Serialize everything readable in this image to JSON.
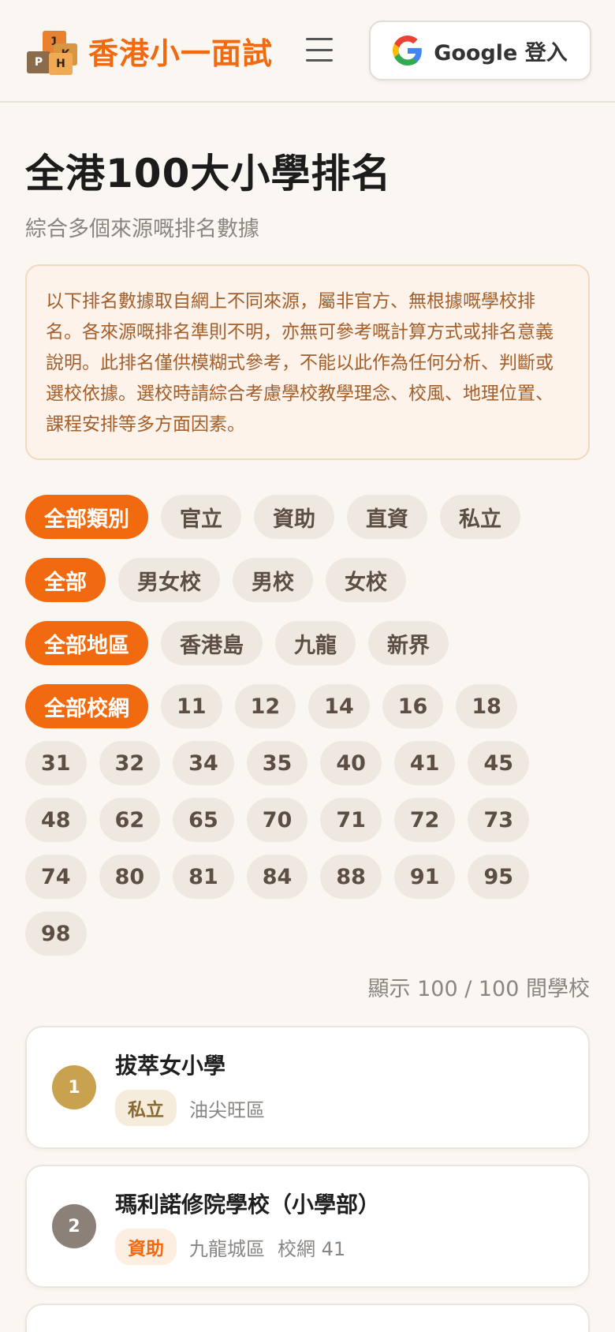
{
  "header": {
    "brand": "香港小一面試",
    "logo_letters": [
      "1",
      "K",
      "P",
      "H"
    ],
    "login_label": "Google 登入",
    "colors": {
      "accent": "#f26a10"
    }
  },
  "page": {
    "title": "全港100大小學排名",
    "subtitle": "綜合多個來源嘅排名數據",
    "notice": "以下排名數據取自網上不同來源，屬非官方、無根據嘅學校排名。各來源嘅排名準則不明，亦無可參考嘅計算方式或排名意義說明。此排名僅供模糊式參考，不能以此作為任何分析、判斷或選校依據。選校時請綜合考慮學校教學理念、校風、地理位置、課程安排等多方面因素。"
  },
  "filters": {
    "category": [
      {
        "label": "全部類別",
        "active": true
      },
      {
        "label": "官立",
        "active": false
      },
      {
        "label": "資助",
        "active": false
      },
      {
        "label": "直資",
        "active": false
      },
      {
        "label": "私立",
        "active": false
      }
    ],
    "gender": [
      {
        "label": "全部",
        "active": true
      },
      {
        "label": "男女校",
        "active": false
      },
      {
        "label": "男校",
        "active": false
      },
      {
        "label": "女校",
        "active": false
      }
    ],
    "region": [
      {
        "label": "全部地區",
        "active": true
      },
      {
        "label": "香港島",
        "active": false
      },
      {
        "label": "九龍",
        "active": false
      },
      {
        "label": "新界",
        "active": false
      }
    ],
    "net_all": "全部校網",
    "nets": [
      "11",
      "12",
      "14",
      "16",
      "18",
      "31",
      "32",
      "34",
      "35",
      "40",
      "41",
      "45",
      "48",
      "62",
      "65",
      "70",
      "71",
      "72",
      "73",
      "74",
      "80",
      "81",
      "84",
      "88",
      "91",
      "95",
      "98"
    ]
  },
  "count_text": "顯示 100 / 100 間學校",
  "schools": [
    {
      "rank": "1",
      "name": "拔萃女小學",
      "type": "私立",
      "district": "油尖旺區",
      "net": "",
      "rank_color": "#c9a24f",
      "tag_bg": "#f5ecdc",
      "tag_color": "#8a6a32"
    },
    {
      "rank": "2",
      "name": "瑪利諾修院學校（小學部）",
      "type": "資助",
      "district": "九龍城區",
      "net": "校網 41",
      "rank_color": "#8b8179",
      "tag_bg": "#fdeee2",
      "tag_color": "#f26a10"
    }
  ]
}
